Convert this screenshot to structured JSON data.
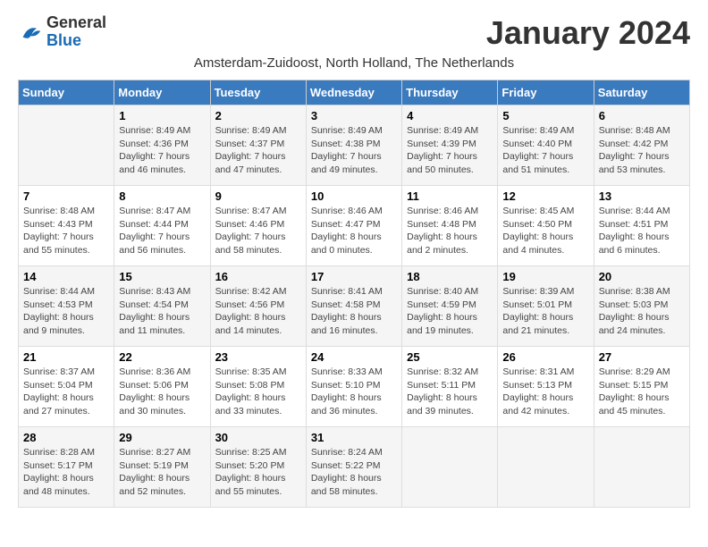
{
  "logo": {
    "general": "General",
    "blue": "Blue"
  },
  "title": "January 2024",
  "subtitle": "Amsterdam-Zuidoost, North Holland, The Netherlands",
  "days_header": [
    "Sunday",
    "Monday",
    "Tuesday",
    "Wednesday",
    "Thursday",
    "Friday",
    "Saturday"
  ],
  "weeks": [
    [
      {
        "day": "",
        "info": ""
      },
      {
        "day": "1",
        "info": "Sunrise: 8:49 AM\nSunset: 4:36 PM\nDaylight: 7 hours\nand 46 minutes."
      },
      {
        "day": "2",
        "info": "Sunrise: 8:49 AM\nSunset: 4:37 PM\nDaylight: 7 hours\nand 47 minutes."
      },
      {
        "day": "3",
        "info": "Sunrise: 8:49 AM\nSunset: 4:38 PM\nDaylight: 7 hours\nand 49 minutes."
      },
      {
        "day": "4",
        "info": "Sunrise: 8:49 AM\nSunset: 4:39 PM\nDaylight: 7 hours\nand 50 minutes."
      },
      {
        "day": "5",
        "info": "Sunrise: 8:49 AM\nSunset: 4:40 PM\nDaylight: 7 hours\nand 51 minutes."
      },
      {
        "day": "6",
        "info": "Sunrise: 8:48 AM\nSunset: 4:42 PM\nDaylight: 7 hours\nand 53 minutes."
      }
    ],
    [
      {
        "day": "7",
        "info": "Sunrise: 8:48 AM\nSunset: 4:43 PM\nDaylight: 7 hours\nand 55 minutes."
      },
      {
        "day": "8",
        "info": "Sunrise: 8:47 AM\nSunset: 4:44 PM\nDaylight: 7 hours\nand 56 minutes."
      },
      {
        "day": "9",
        "info": "Sunrise: 8:47 AM\nSunset: 4:46 PM\nDaylight: 7 hours\nand 58 minutes."
      },
      {
        "day": "10",
        "info": "Sunrise: 8:46 AM\nSunset: 4:47 PM\nDaylight: 8 hours\nand 0 minutes."
      },
      {
        "day": "11",
        "info": "Sunrise: 8:46 AM\nSunset: 4:48 PM\nDaylight: 8 hours\nand 2 minutes."
      },
      {
        "day": "12",
        "info": "Sunrise: 8:45 AM\nSunset: 4:50 PM\nDaylight: 8 hours\nand 4 minutes."
      },
      {
        "day": "13",
        "info": "Sunrise: 8:44 AM\nSunset: 4:51 PM\nDaylight: 8 hours\nand 6 minutes."
      }
    ],
    [
      {
        "day": "14",
        "info": "Sunrise: 8:44 AM\nSunset: 4:53 PM\nDaylight: 8 hours\nand 9 minutes."
      },
      {
        "day": "15",
        "info": "Sunrise: 8:43 AM\nSunset: 4:54 PM\nDaylight: 8 hours\nand 11 minutes."
      },
      {
        "day": "16",
        "info": "Sunrise: 8:42 AM\nSunset: 4:56 PM\nDaylight: 8 hours\nand 14 minutes."
      },
      {
        "day": "17",
        "info": "Sunrise: 8:41 AM\nSunset: 4:58 PM\nDaylight: 8 hours\nand 16 minutes."
      },
      {
        "day": "18",
        "info": "Sunrise: 8:40 AM\nSunset: 4:59 PM\nDaylight: 8 hours\nand 19 minutes."
      },
      {
        "day": "19",
        "info": "Sunrise: 8:39 AM\nSunset: 5:01 PM\nDaylight: 8 hours\nand 21 minutes."
      },
      {
        "day": "20",
        "info": "Sunrise: 8:38 AM\nSunset: 5:03 PM\nDaylight: 8 hours\nand 24 minutes."
      }
    ],
    [
      {
        "day": "21",
        "info": "Sunrise: 8:37 AM\nSunset: 5:04 PM\nDaylight: 8 hours\nand 27 minutes."
      },
      {
        "day": "22",
        "info": "Sunrise: 8:36 AM\nSunset: 5:06 PM\nDaylight: 8 hours\nand 30 minutes."
      },
      {
        "day": "23",
        "info": "Sunrise: 8:35 AM\nSunset: 5:08 PM\nDaylight: 8 hours\nand 33 minutes."
      },
      {
        "day": "24",
        "info": "Sunrise: 8:33 AM\nSunset: 5:10 PM\nDaylight: 8 hours\nand 36 minutes."
      },
      {
        "day": "25",
        "info": "Sunrise: 8:32 AM\nSunset: 5:11 PM\nDaylight: 8 hours\nand 39 minutes."
      },
      {
        "day": "26",
        "info": "Sunrise: 8:31 AM\nSunset: 5:13 PM\nDaylight: 8 hours\nand 42 minutes."
      },
      {
        "day": "27",
        "info": "Sunrise: 8:29 AM\nSunset: 5:15 PM\nDaylight: 8 hours\nand 45 minutes."
      }
    ],
    [
      {
        "day": "28",
        "info": "Sunrise: 8:28 AM\nSunset: 5:17 PM\nDaylight: 8 hours\nand 48 minutes."
      },
      {
        "day": "29",
        "info": "Sunrise: 8:27 AM\nSunset: 5:19 PM\nDaylight: 8 hours\nand 52 minutes."
      },
      {
        "day": "30",
        "info": "Sunrise: 8:25 AM\nSunset: 5:20 PM\nDaylight: 8 hours\nand 55 minutes."
      },
      {
        "day": "31",
        "info": "Sunrise: 8:24 AM\nSunset: 5:22 PM\nDaylight: 8 hours\nand 58 minutes."
      },
      {
        "day": "",
        "info": ""
      },
      {
        "day": "",
        "info": ""
      },
      {
        "day": "",
        "info": ""
      }
    ]
  ]
}
